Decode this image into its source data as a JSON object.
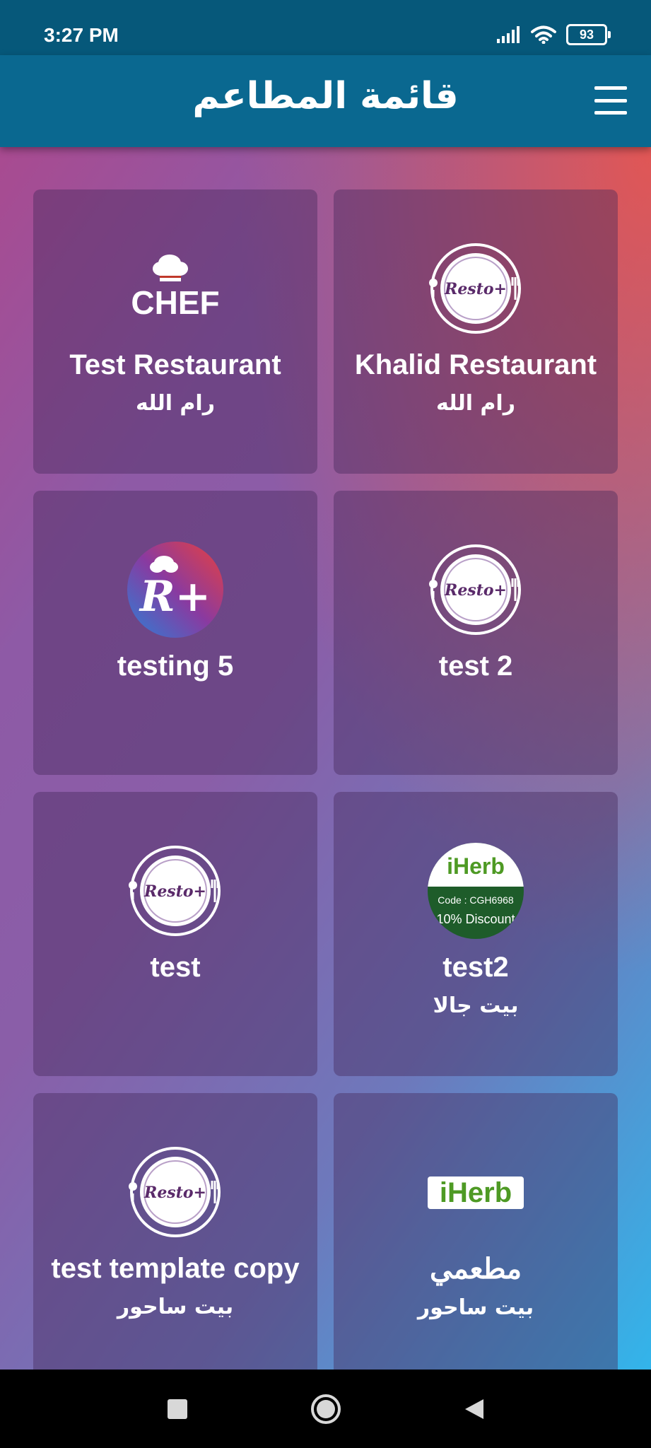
{
  "status_bar": {
    "time": "3:27 PM",
    "battery": "93"
  },
  "app_bar": {
    "title": "قائمة المطاعم"
  },
  "restaurants": [
    {
      "name": "Test Restaurant",
      "city": "رام الله",
      "logo": "chef-logo",
      "logo_text": "CHEF"
    },
    {
      "name": "Khalid Restaurant",
      "city": "رام الله",
      "logo": "resto-plus-logo",
      "logo_text": "Resto+"
    },
    {
      "name": "testing 5",
      "city": "",
      "logo": "r-plus-logo",
      "logo_text": "R+"
    },
    {
      "name": "test 2",
      "city": "",
      "logo": "resto-plus-logo",
      "logo_text": "Resto+"
    },
    {
      "name": "test",
      "city": "",
      "logo": "resto-plus-logo",
      "logo_text": "Resto+"
    },
    {
      "name": "test2",
      "city": "بيت جالا",
      "logo": "iherb-discount-logo",
      "logo_text": "iHerb",
      "logo_code": "Code : CGH6968",
      "logo_discount": "10% Discount"
    },
    {
      "name": "test template copy",
      "city": "بيت ساحور",
      "logo": "resto-plus-logo",
      "logo_text": "Resto+"
    },
    {
      "name": "مطعمي",
      "city": "بيت ساحور",
      "logo": "iherb-logo",
      "logo_text": "iHerb"
    }
  ],
  "colors": {
    "status_bar": "#06587a",
    "app_bar": "#0a6890",
    "iherb_green": "#4e9a24",
    "iherb_dark_green": "#1e5c2a"
  }
}
